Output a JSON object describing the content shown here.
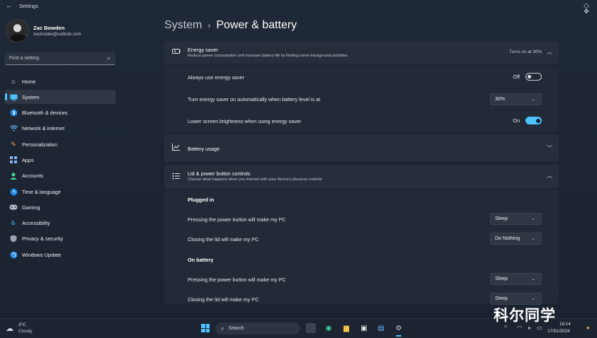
{
  "window": {
    "title": "Settings"
  },
  "user": {
    "name": "Zac Bowden",
    "email": "zacinsider@outlook.com"
  },
  "search": {
    "placeholder": "Find a setting"
  },
  "nav": {
    "items": [
      {
        "label": "Home",
        "icon": "home-icon"
      },
      {
        "label": "System",
        "icon": "system-icon",
        "active": true
      },
      {
        "label": "Bluetooth & devices",
        "icon": "bluetooth-icon"
      },
      {
        "label": "Network & internet",
        "icon": "wifi-icon"
      },
      {
        "label": "Personalization",
        "icon": "brush-icon"
      },
      {
        "label": "Apps",
        "icon": "apps-icon"
      },
      {
        "label": "Accounts",
        "icon": "person-icon"
      },
      {
        "label": "Time & language",
        "icon": "globe-clock-icon"
      },
      {
        "label": "Gaming",
        "icon": "gamepad-icon"
      },
      {
        "label": "Accessibility",
        "icon": "accessibility-icon"
      },
      {
        "label": "Privacy & security",
        "icon": "shield-icon"
      },
      {
        "label": "Windows Update",
        "icon": "update-icon"
      }
    ]
  },
  "breadcrumb": {
    "parent": "System",
    "current": "Power & battery"
  },
  "energy_saver": {
    "title": "Energy saver",
    "description": "Reduce power consumption and increase battery life by limiting some background activities",
    "status": "Turns on at 30%",
    "always_label": "Always use energy saver",
    "always_state": "Off",
    "auto_label": "Turn energy saver on automatically when battery level is at",
    "auto_value": "30%",
    "brightness_label": "Lower screen brightness when using energy saver",
    "brightness_state": "On"
  },
  "battery_usage": {
    "title": "Battery usage"
  },
  "lid": {
    "title": "Lid & power button controls",
    "description": "Choose what happens when you interact with your device's physical controls",
    "plugged_in": "Plugged in",
    "on_battery": "On battery",
    "power_button_label": "Pressing the power button will make my PC",
    "lid_label": "Closing the lid will make my PC",
    "plugged_power_value": "Sleep",
    "plugged_lid_value": "Do Nothing",
    "battery_power_value": "Sleep",
    "battery_lid_value": "Sleep"
  },
  "taskbar": {
    "temp": "3°C",
    "condition": "Cloudy",
    "search_label": "Search",
    "time": "16:14",
    "date": "17/01/2024"
  },
  "watermark": "科尔同学",
  "colors": {
    "accent": "#4cc2ff",
    "card": "#262e3b",
    "background": "#1f2836"
  }
}
